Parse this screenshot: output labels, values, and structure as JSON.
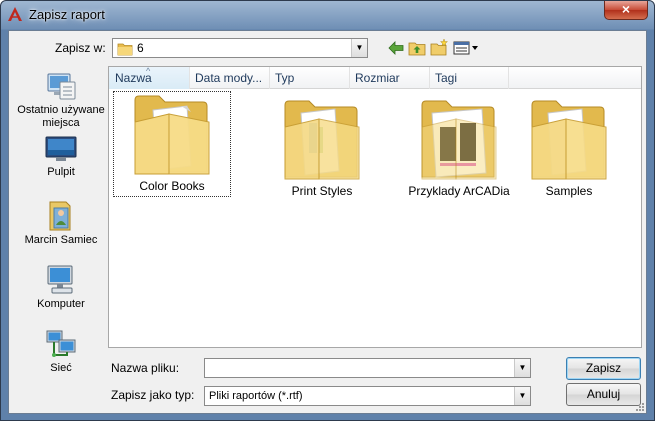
{
  "window": {
    "title": "Zapisz raport",
    "close_label": "×"
  },
  "lookin": {
    "label": "Zapisz w:",
    "value": "6"
  },
  "toolbar": {
    "back_icon": "back-arrow-icon",
    "up_icon": "folder-up-icon",
    "new_folder_icon": "new-folder-icon",
    "views_icon": "views-menu-icon"
  },
  "places": [
    {
      "label": "Ostatnio używane miejsca",
      "icon": "recent-places-icon"
    },
    {
      "label": "Pulpit",
      "icon": "desktop-icon"
    },
    {
      "label": "Marcin Samiec",
      "icon": "user-folder-icon"
    },
    {
      "label": "Komputer",
      "icon": "computer-icon"
    },
    {
      "label": "Sieć",
      "icon": "network-icon"
    }
  ],
  "columns": [
    "Nazwa",
    "Data mody...",
    "Typ",
    "Rozmiar",
    "Tagi"
  ],
  "items": [
    {
      "name": "Color Books",
      "selected": true
    },
    {
      "name": "Print Styles",
      "selected": false
    },
    {
      "name": "Przyklady ArCADia",
      "selected": false
    },
    {
      "name": "Samples",
      "selected": false
    }
  ],
  "filename": {
    "label": "Nazwa pliku:",
    "value": ""
  },
  "filetype": {
    "label": "Zapisz jako typ:",
    "value": "Pliki raportów (*.rtf)"
  },
  "buttons": {
    "save": "Zapisz",
    "cancel": "Anuluj"
  },
  "colors": {
    "title_gradient_top": "#9fb7d2",
    "close_red": "#c74a35",
    "folder_yellow": "#f3d27a"
  }
}
